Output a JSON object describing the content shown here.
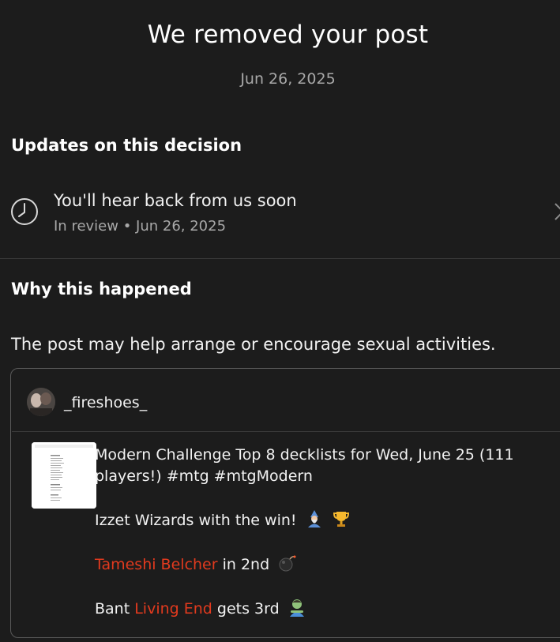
{
  "header": {
    "title": "We removed your post",
    "date": "Jun 26, 2025"
  },
  "updates": {
    "heading": "Updates on this decision",
    "item": {
      "title": "You'll hear back from us soon",
      "status": "In review",
      "separator": " • ",
      "date": "Jun 26, 2025"
    }
  },
  "why": {
    "heading": "Why this happened",
    "reason": "The post may help arrange or encourage sexual activities."
  },
  "post": {
    "username": "_fireshoes_",
    "line1": "Modern Challenge Top 8 decklists for Wed, June 25 (111 players!) #mtg #mtgModern",
    "line2": "Izzet Wizards with the win!",
    "line3_link": "Tameshi Belcher",
    "line3_rest": " in 2nd",
    "line4_pre": "Bant ",
    "line4_link": "Living End",
    "line4_rest": " gets 3rd"
  },
  "colors": {
    "background": "#1c1c1c",
    "muted_text": "#a8a8a8",
    "link": "#e23a1e",
    "divider": "#3a3a3a"
  },
  "icons": {
    "update_status": "clock-icon",
    "update_open": "chevron-right-icon",
    "winner": [
      "mage-emoji",
      "trophy-emoji"
    ],
    "second": "bomb-emoji",
    "third": "zombie-emoji"
  }
}
